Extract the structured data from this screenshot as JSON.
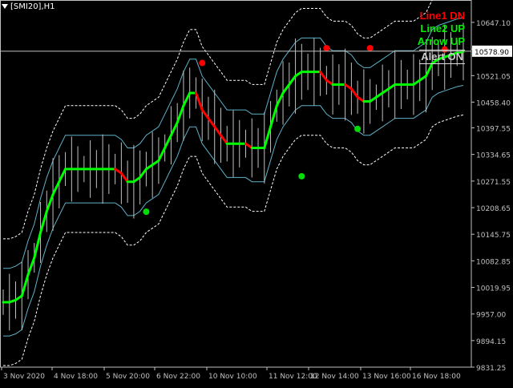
{
  "window": {
    "symbol_label": "[SMI20],H1"
  },
  "colors": {
    "background": "#000000",
    "axis": "#c0c0c0",
    "candle": "#c0c0c0",
    "channel": "#5fb0c8",
    "envelope": "#ffffff",
    "line_up": "#00ff00",
    "line_dn": "#ff0000",
    "arrow_up": "#00dd00",
    "arrow_dn": "#ff0000",
    "current_price": "#c0c0c0"
  },
  "legend": {
    "line1": "Line1 DN",
    "line2": "Line2 UP",
    "arrow": "Arrow  UP",
    "alert": "Alert  ON"
  },
  "chart_data": {
    "type": "line",
    "ylim": [
      9831.25,
      10700
    ],
    "y_ticks": [
      "10647.10",
      "10584.00",
      "10521.05",
      "10458.40",
      "10397.55",
      "10334.65",
      "10271.55",
      "10208.65",
      "10145.75",
      "10082.85",
      "10019.95",
      "9957.00",
      "9894.15",
      "9831.25"
    ],
    "current_price": "10578.90",
    "x_tick_labels": [
      "3 Nov 2020",
      "4 Nov 18:00",
      "5 Nov 20:00",
      "6 Nov 22:00",
      "10 Nov 10:00",
      "11 Nov 12:00",
      "12 Nov 14:00",
      "13 Nov 16:00",
      "16 Nov 18:00"
    ],
    "series": [
      {
        "name": "Line2 UP",
        "values": [
          9985,
          9985,
          9990,
          10000,
          10050,
          10090,
          10150,
          10200,
          10240,
          10270,
          10300,
          10300,
          10300,
          10300,
          10300,
          10300,
          10300,
          10300,
          10300,
          10290,
          10270,
          10270,
          10280,
          10300,
          10310,
          10320,
          10350,
          10380,
          10410,
          10450,
          10480,
          10480,
          10440,
          10420,
          10400,
          10380,
          10360,
          10360,
          10360,
          10360,
          10350,
          10350,
          10350,
          10400,
          10450,
          10480,
          10500,
          10520,
          10530,
          10530,
          10530,
          10530,
          10510,
          10500,
          10500,
          10500,
          10490,
          10470,
          10460,
          10460,
          10470,
          10480,
          10490,
          10500,
          10500,
          10500,
          10500,
          10510,
          10520,
          10550,
          10560,
          10565,
          10570,
          10575,
          10578
        ]
      }
    ],
    "signals": {
      "arrow_up_values": [
        10199,
        10283,
        10395
      ],
      "arrow_dn_values": [
        10551,
        10586,
        10586,
        10583
      ]
    }
  }
}
